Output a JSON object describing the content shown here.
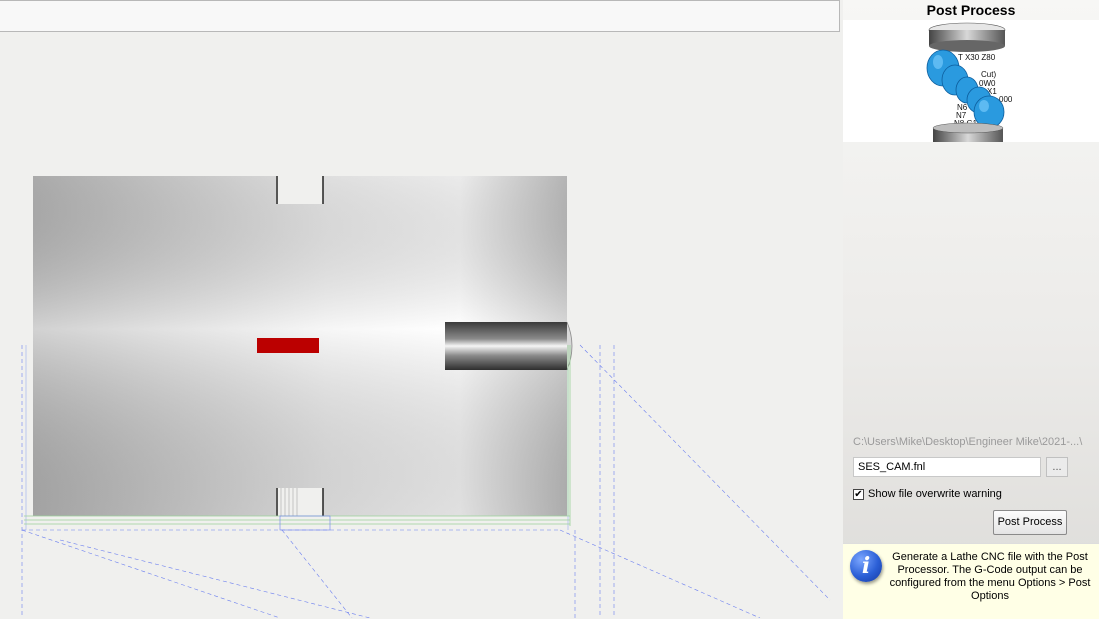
{
  "panel": {
    "title": "Post Process",
    "file_path": "C:\\Users\\Mike\\Desktop\\Engineer Mike\\2021-...\\",
    "file_name": "SES_CAM.fnl",
    "browse_label": "...",
    "overwrite_checked": true,
    "overwrite_check_glyph": "✔",
    "overwrite_label": "Show file overwrite warning",
    "post_process_button": "Post Process",
    "info_icon": "i",
    "info_text": "Generate a Lathe CNC file with the Post Processor. The G-Code output can be configured from the menu Options > Post Options"
  },
  "illustration": {
    "gcode_lines": [
      "T X30 Z80",
      "Cut)",
      "0W0",
      "X1",
      "000",
      "N6",
      "N7",
      "N8 G1 X"
    ]
  },
  "colors": {
    "part_red": "#bb0000",
    "tool_blue": "#2a9adf",
    "guide_line_blue": "#6a7ef0"
  }
}
